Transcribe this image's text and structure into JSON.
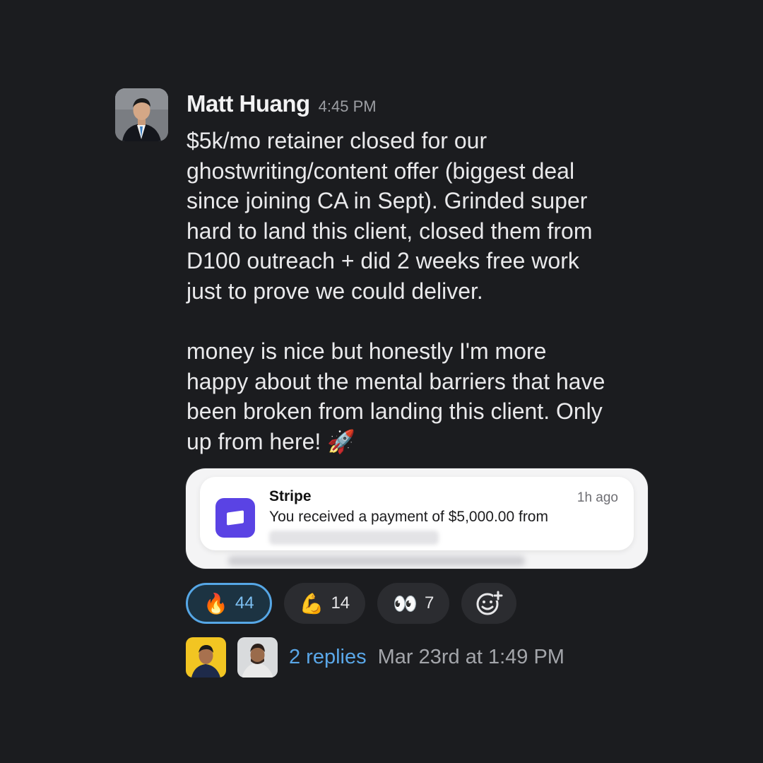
{
  "message": {
    "author": "Matt Huang",
    "timestamp": "4:45 PM",
    "body": "$5k/mo retainer closed for our\nghostwriting/content offer (biggest deal\nsince joining CA in Sept). Grinded super\nhard to land this client, closed them from\nD100 outreach + did 2 weeks free work\njust to prove we could deliver.\n\nmoney is nice but honestly I'm more\nhappy about the mental barriers that have\nbeen broken from landing this client. Only\nup from here! 🚀"
  },
  "attachment": {
    "app": "Stripe",
    "time": "1h ago",
    "text": "You received a payment of $5,000.00 from"
  },
  "reactions": [
    {
      "emoji": "🔥",
      "count": "44",
      "active": true
    },
    {
      "emoji": "💪",
      "count": "14",
      "active": false
    },
    {
      "emoji": "👀",
      "count": "7",
      "active": false
    }
  ],
  "thread": {
    "replies": "2 replies",
    "date": "Mar 23rd at 1:49 PM"
  },
  "colors": {
    "background": "#1b1c1f",
    "link": "#5aa7e8",
    "active_reaction_border": "#56a7e6",
    "stripe_brand": "#5a43e4"
  },
  "icons": {
    "add_reaction": "add-reaction-icon"
  }
}
